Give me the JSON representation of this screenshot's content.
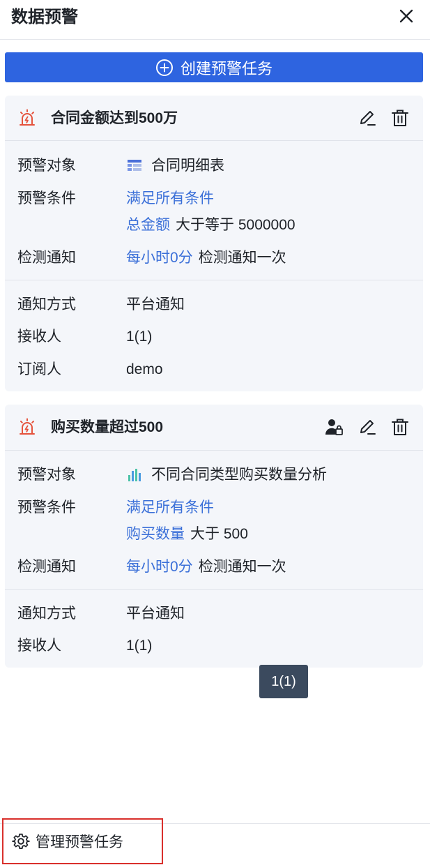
{
  "header": {
    "title": "数据预警"
  },
  "actions": {
    "create_label": "创建预警任务"
  },
  "cards": [
    {
      "title": "合同金额达到500万",
      "rows": {
        "object": {
          "label": "预警对象",
          "value": "合同明细表"
        },
        "condition": {
          "label": "预警条件",
          "mode": "满足所有条件",
          "field": "总金额",
          "rule": "大于等于 5000000"
        },
        "schedule": {
          "label": "检测通知",
          "time": "每小时0分",
          "text": "检测通知一次"
        },
        "method": {
          "label": "通知方式",
          "value": "平台通知"
        },
        "receiver": {
          "label": "接收人",
          "value": "1(1)"
        },
        "subscriber": {
          "label": "订阅人",
          "value": "demo"
        }
      }
    },
    {
      "title": "购买数量超过500",
      "rows": {
        "object": {
          "label": "预警对象",
          "value": "不同合同类型购买数量分析"
        },
        "condition": {
          "label": "预警条件",
          "mode": "满足所有条件",
          "field": "购买数量",
          "rule": "大于 500"
        },
        "schedule": {
          "label": "检测通知",
          "time": "每小时0分",
          "text": "检测通知一次"
        },
        "method": {
          "label": "通知方式",
          "value": "平台通知"
        },
        "receiver": {
          "label": "接收人",
          "value": "1(1)"
        }
      }
    }
  ],
  "tooltip": {
    "text": "1(1)"
  },
  "footer": {
    "manage_label": "管理预警任务"
  },
  "colors": {
    "primary": "#2e64e0",
    "link": "#3a6fd8",
    "alarm": "#e5533d",
    "card_bg": "#f4f6fa",
    "highlight_border": "#d9302c",
    "tooltip_bg": "#3b4a5e"
  },
  "icons": {
    "close": "close-icon",
    "create": "plus-circle-icon",
    "alarm": "alarm-light-icon",
    "edit": "edit-icon",
    "delete": "trash-icon",
    "user_lock": "user-lock-icon",
    "table": "table-icon",
    "bar_chart": "bar-chart-icon",
    "gear": "gear-icon"
  }
}
